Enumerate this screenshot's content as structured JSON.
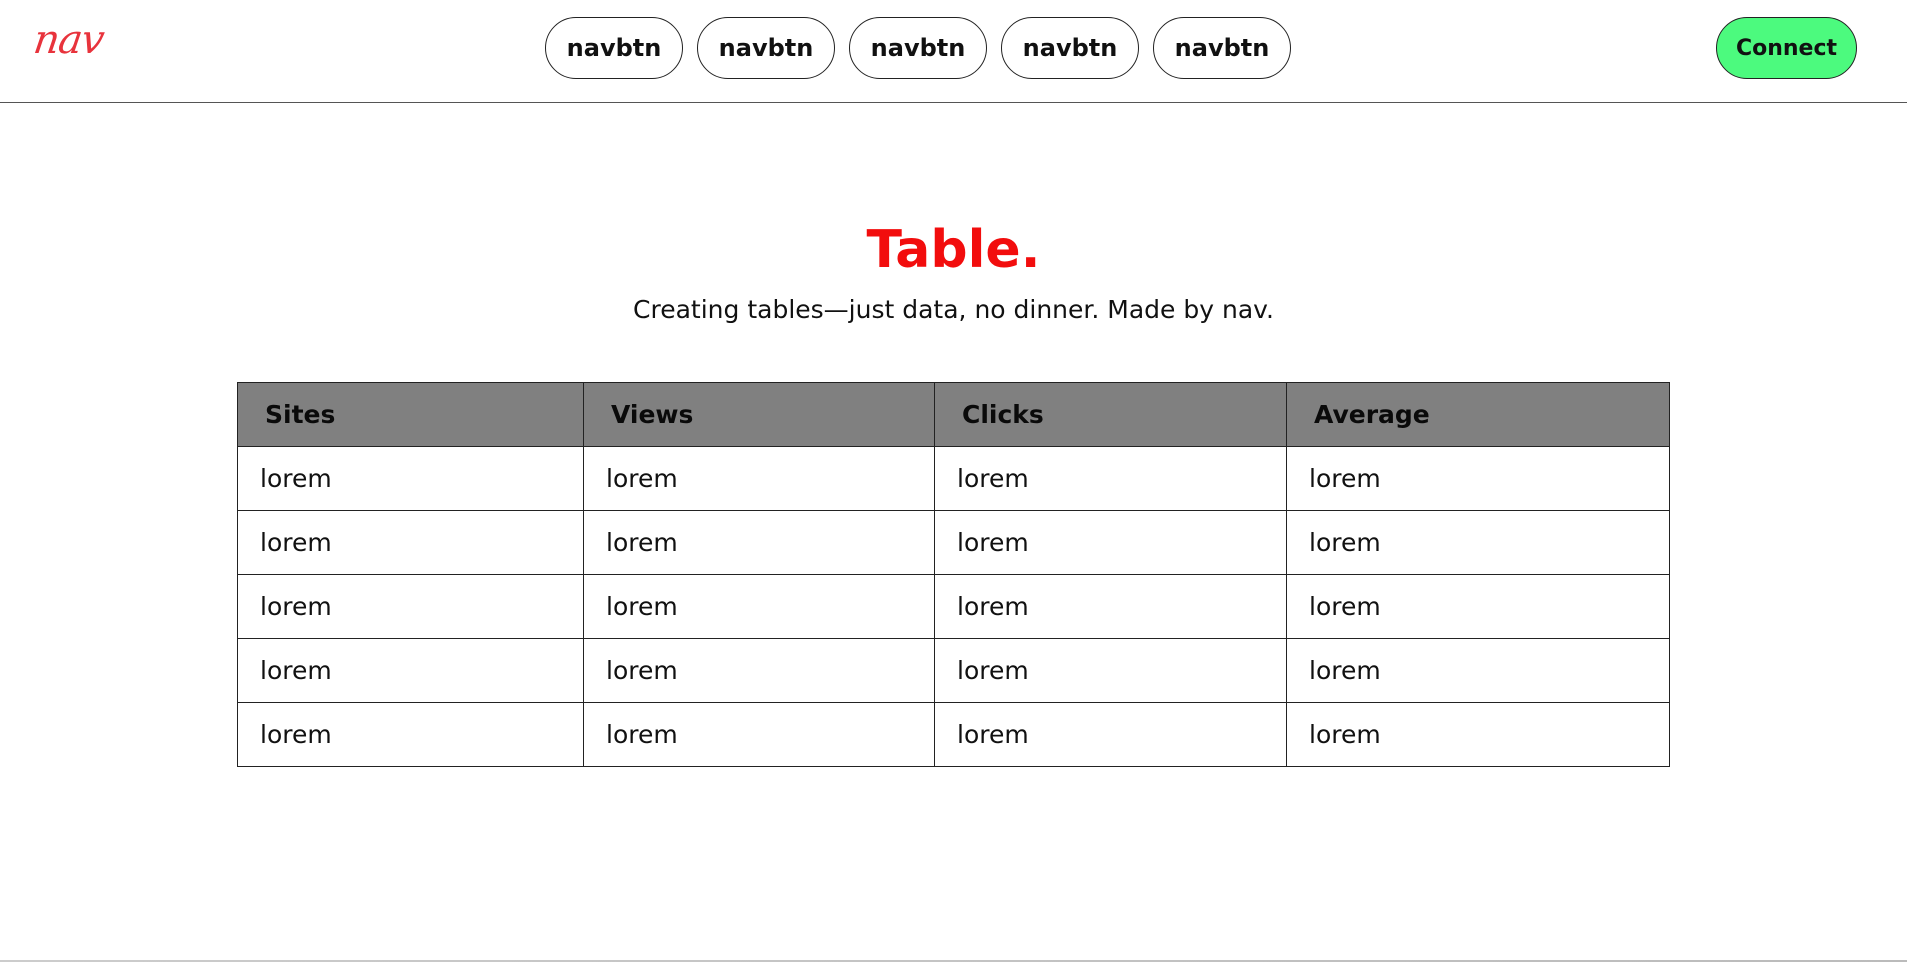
{
  "header": {
    "logo_text": "nav",
    "nav_items": [
      "navbtn",
      "navbtn",
      "navbtn",
      "navbtn",
      "navbtn"
    ],
    "connect_label": "Connect",
    "colors": {
      "logo": "#e8333c",
      "connect_bg": "#4cfa7e"
    }
  },
  "main": {
    "title": "Table.",
    "subtitle": "Creating tables—just data, no dinner. Made by nav.",
    "title_color": "#f20d0d"
  },
  "table": {
    "columns": [
      "Sites",
      "Views",
      "Clicks",
      "Average"
    ],
    "rows": [
      [
        "lorem",
        "lorem",
        "lorem",
        "lorem"
      ],
      [
        "lorem",
        "lorem",
        "lorem",
        "lorem"
      ],
      [
        "lorem",
        "lorem",
        "lorem",
        "lorem"
      ],
      [
        "lorem",
        "lorem",
        "lorem",
        "lorem"
      ],
      [
        "lorem",
        "lorem",
        "lorem",
        "lorem"
      ]
    ],
    "header_bg": "#808080"
  }
}
